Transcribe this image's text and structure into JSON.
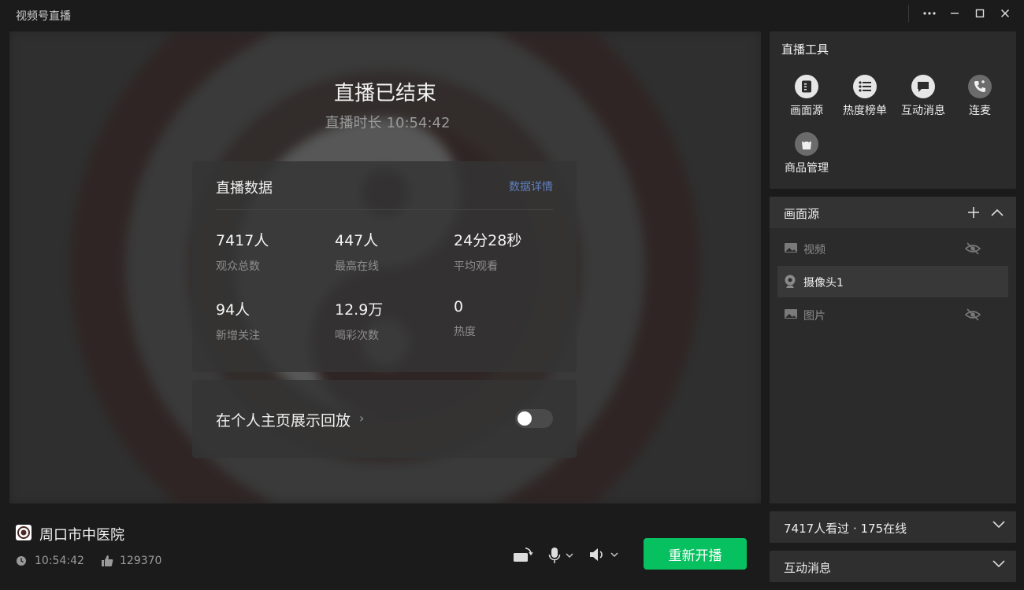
{
  "app": {
    "title": "视频号直播"
  },
  "window_controls": {
    "more": "more-icon",
    "minimize": "minimize-icon",
    "maximize": "maximize-icon",
    "close": "close-icon"
  },
  "main": {
    "ended_title": "直播已结束",
    "duration_label": "直播时长",
    "duration_value": "10:54:42",
    "data_card": {
      "title": "直播数据",
      "detail_link": "数据详情",
      "stats": [
        {
          "value": "7417人",
          "label": "观众总数"
        },
        {
          "value": "447人",
          "label": "最高在线"
        },
        {
          "value": "24分28秒",
          "label": "平均观看"
        },
        {
          "value": "94人",
          "label": "新增关注"
        },
        {
          "value": "12.9万",
          "label": "喝彩次数"
        },
        {
          "value": "0",
          "label": "热度"
        }
      ]
    },
    "replay": {
      "label": "在个人主页展示回放",
      "toggle_on": false
    }
  },
  "bottom": {
    "channel_name": "周口市中医院",
    "duration": "10:54:42",
    "likes": "129370",
    "restart_button": "重新开播"
  },
  "tools": {
    "title": "直播工具",
    "items": [
      {
        "label": "画面源",
        "icon": "document-icon"
      },
      {
        "label": "热度榜单",
        "icon": "list-icon"
      },
      {
        "label": "互动消息",
        "icon": "chat-icon"
      },
      {
        "label": "连麦",
        "icon": "phone-call-icon"
      },
      {
        "label": "商品管理",
        "icon": "shopping-bag-icon"
      }
    ]
  },
  "sources": {
    "title": "画面源",
    "items": [
      {
        "label": "视频",
        "icon": "image-icon",
        "hidden": true
      },
      {
        "label": "摄像头1",
        "icon": "camera-icon",
        "hidden": false
      },
      {
        "label": "图片",
        "icon": "image-icon",
        "hidden": true
      }
    ]
  },
  "viewers_panel": {
    "label": "7417人看过 · 175在线"
  },
  "messages_panel": {
    "label": "互动消息"
  },
  "colors": {
    "accent_green": "#07c160",
    "link_blue": "#5f7fc0"
  }
}
